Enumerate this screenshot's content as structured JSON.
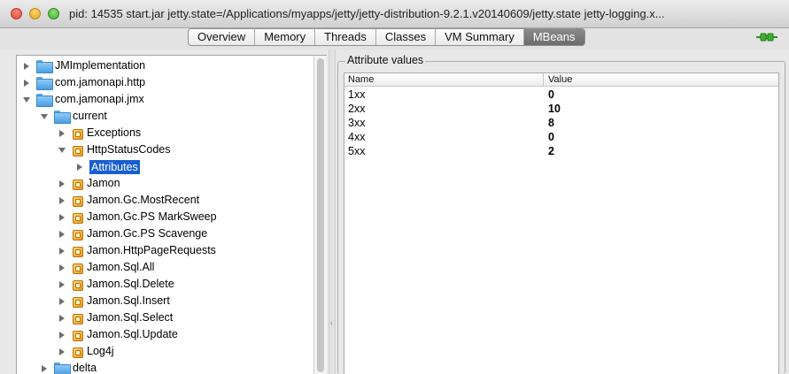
{
  "window": {
    "title": "pid: 14535 start.jar jetty.state=/Applications/myapps/jetty/jetty-distribution-9.2.1.v20140609/jetty.state jetty-logging.x..."
  },
  "tabs": [
    "Overview",
    "Memory",
    "Threads",
    "Classes",
    "VM Summary",
    "MBeans"
  ],
  "active_tab": "MBeans",
  "tree": {
    "items": [
      {
        "label": "JMImplementation",
        "icon": "folder-icon",
        "expander": "collapsed"
      },
      {
        "label": "com.jamonapi.http",
        "icon": "folder-icon",
        "expander": "collapsed"
      },
      {
        "label": "com.jamonapi.jmx",
        "icon": "folder-icon",
        "expander": "expanded"
      },
      {
        "label": "current",
        "icon": "folder-icon",
        "expander": "expanded"
      },
      {
        "label": "Exceptions",
        "icon": "mbean-icon",
        "expander": "collapsed"
      },
      {
        "label": "HttpStatusCodes",
        "icon": "mbean-icon",
        "expander": "expanded"
      },
      {
        "label": "Attributes",
        "icon": "",
        "expander": "collapsed",
        "selected": true
      },
      {
        "label": "Jamon",
        "icon": "mbean-icon",
        "expander": "collapsed"
      },
      {
        "label": "Jamon.Gc.MostRecent",
        "icon": "mbean-icon",
        "expander": "collapsed"
      },
      {
        "label": "Jamon.Gc.PS MarkSweep",
        "icon": "mbean-icon",
        "expander": "collapsed"
      },
      {
        "label": "Jamon.Gc.PS Scavenge",
        "icon": "mbean-icon",
        "expander": "collapsed"
      },
      {
        "label": "Jamon.HttpPageRequests",
        "icon": "mbean-icon",
        "expander": "collapsed"
      },
      {
        "label": "Jamon.Sql.All",
        "icon": "mbean-icon",
        "expander": "collapsed"
      },
      {
        "label": "Jamon.Sql.Delete",
        "icon": "mbean-icon",
        "expander": "collapsed"
      },
      {
        "label": "Jamon.Sql.Insert",
        "icon": "mbean-icon",
        "expander": "collapsed"
      },
      {
        "label": "Jamon.Sql.Select",
        "icon": "mbean-icon",
        "expander": "collapsed"
      },
      {
        "label": "Jamon.Sql.Update",
        "icon": "mbean-icon",
        "expander": "collapsed"
      },
      {
        "label": "Log4j",
        "icon": "mbean-icon",
        "expander": "collapsed"
      },
      {
        "label": "delta",
        "icon": "folder-icon",
        "expander": "collapsed"
      }
    ]
  },
  "attributes": {
    "legend": "Attribute values",
    "columns": [
      "Name",
      "Value"
    ],
    "rows": [
      {
        "name": "1xx",
        "value": "0"
      },
      {
        "name": "2xx",
        "value": "10"
      },
      {
        "name": "3xx",
        "value": "8"
      },
      {
        "name": "4xx",
        "value": "0"
      },
      {
        "name": "5xx",
        "value": "2"
      }
    ]
  },
  "colors": {
    "selection": "#1a5fd1",
    "active_tab": "#7a7a7a",
    "connection_plug": "#3db12e"
  }
}
